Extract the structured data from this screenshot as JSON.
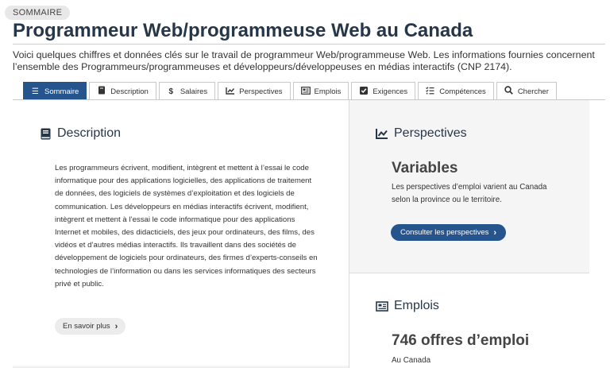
{
  "badge": "SOMMAIRE",
  "title": "Programmeur Web/programmeuse Web au Canada",
  "intro": "Voici quelques chiffres et données clés sur le travail de programmeur Web/programmeuse Web. Les informations fournies concernent l’ensemble des Programmeurs/programmeuses et développeurs/développeuses en médias interactifs (CNP 2174).",
  "tabs": [
    {
      "label": "Sommaire",
      "icon": "list-icon",
      "active": true
    },
    {
      "label": "Description",
      "icon": "book-icon",
      "active": false
    },
    {
      "label": "Salaires",
      "icon": "dollar-icon",
      "active": false
    },
    {
      "label": "Perspectives",
      "icon": "chart-line-icon",
      "active": false
    },
    {
      "label": "Emplois",
      "icon": "newspaper-icon",
      "active": false
    },
    {
      "label": "Exigences",
      "icon": "check-square-icon",
      "active": false
    },
    {
      "label": "Compétences",
      "icon": "tasks-icon",
      "active": false
    },
    {
      "label": "Chercher",
      "icon": "search-icon",
      "active": false
    }
  ],
  "description": {
    "heading": "Description",
    "text": "Les programmeurs écrivent, modifient, intègrent et mettent à l’essai le code informatique pour des applications logicielles, des applications de traitement de données, des logiciels de systèmes d’exploitation et des logiciels de communication. Les développeurs en médias interactifs écrivent, modifient, intègrent et mettent à l’essai le code informatique pour des applications Internet et mobiles, des didacticiels, des jeux pour ordinateurs, des films, des vidéos et d’autres médias interactifs. Ils travaillent dans des sociétés de développement de logiciels pour ordinateurs, des firmes d’experts-conseils en technologies de l’information ou dans les services informatiques des secteurs privé et public.",
    "button": "En savoir plus"
  },
  "perspectives": {
    "heading": "Perspectives",
    "value": "Variables",
    "text": "Les perspectives d’emploi varient au Canada selon la province ou le territoire.",
    "button": "Consulter les perspectives"
  },
  "emplois": {
    "heading": "Emplois",
    "value": "746 offres d’emploi",
    "location": "Au Canada"
  },
  "colors": {
    "accent": "#26548c",
    "heading": "#26374a"
  }
}
